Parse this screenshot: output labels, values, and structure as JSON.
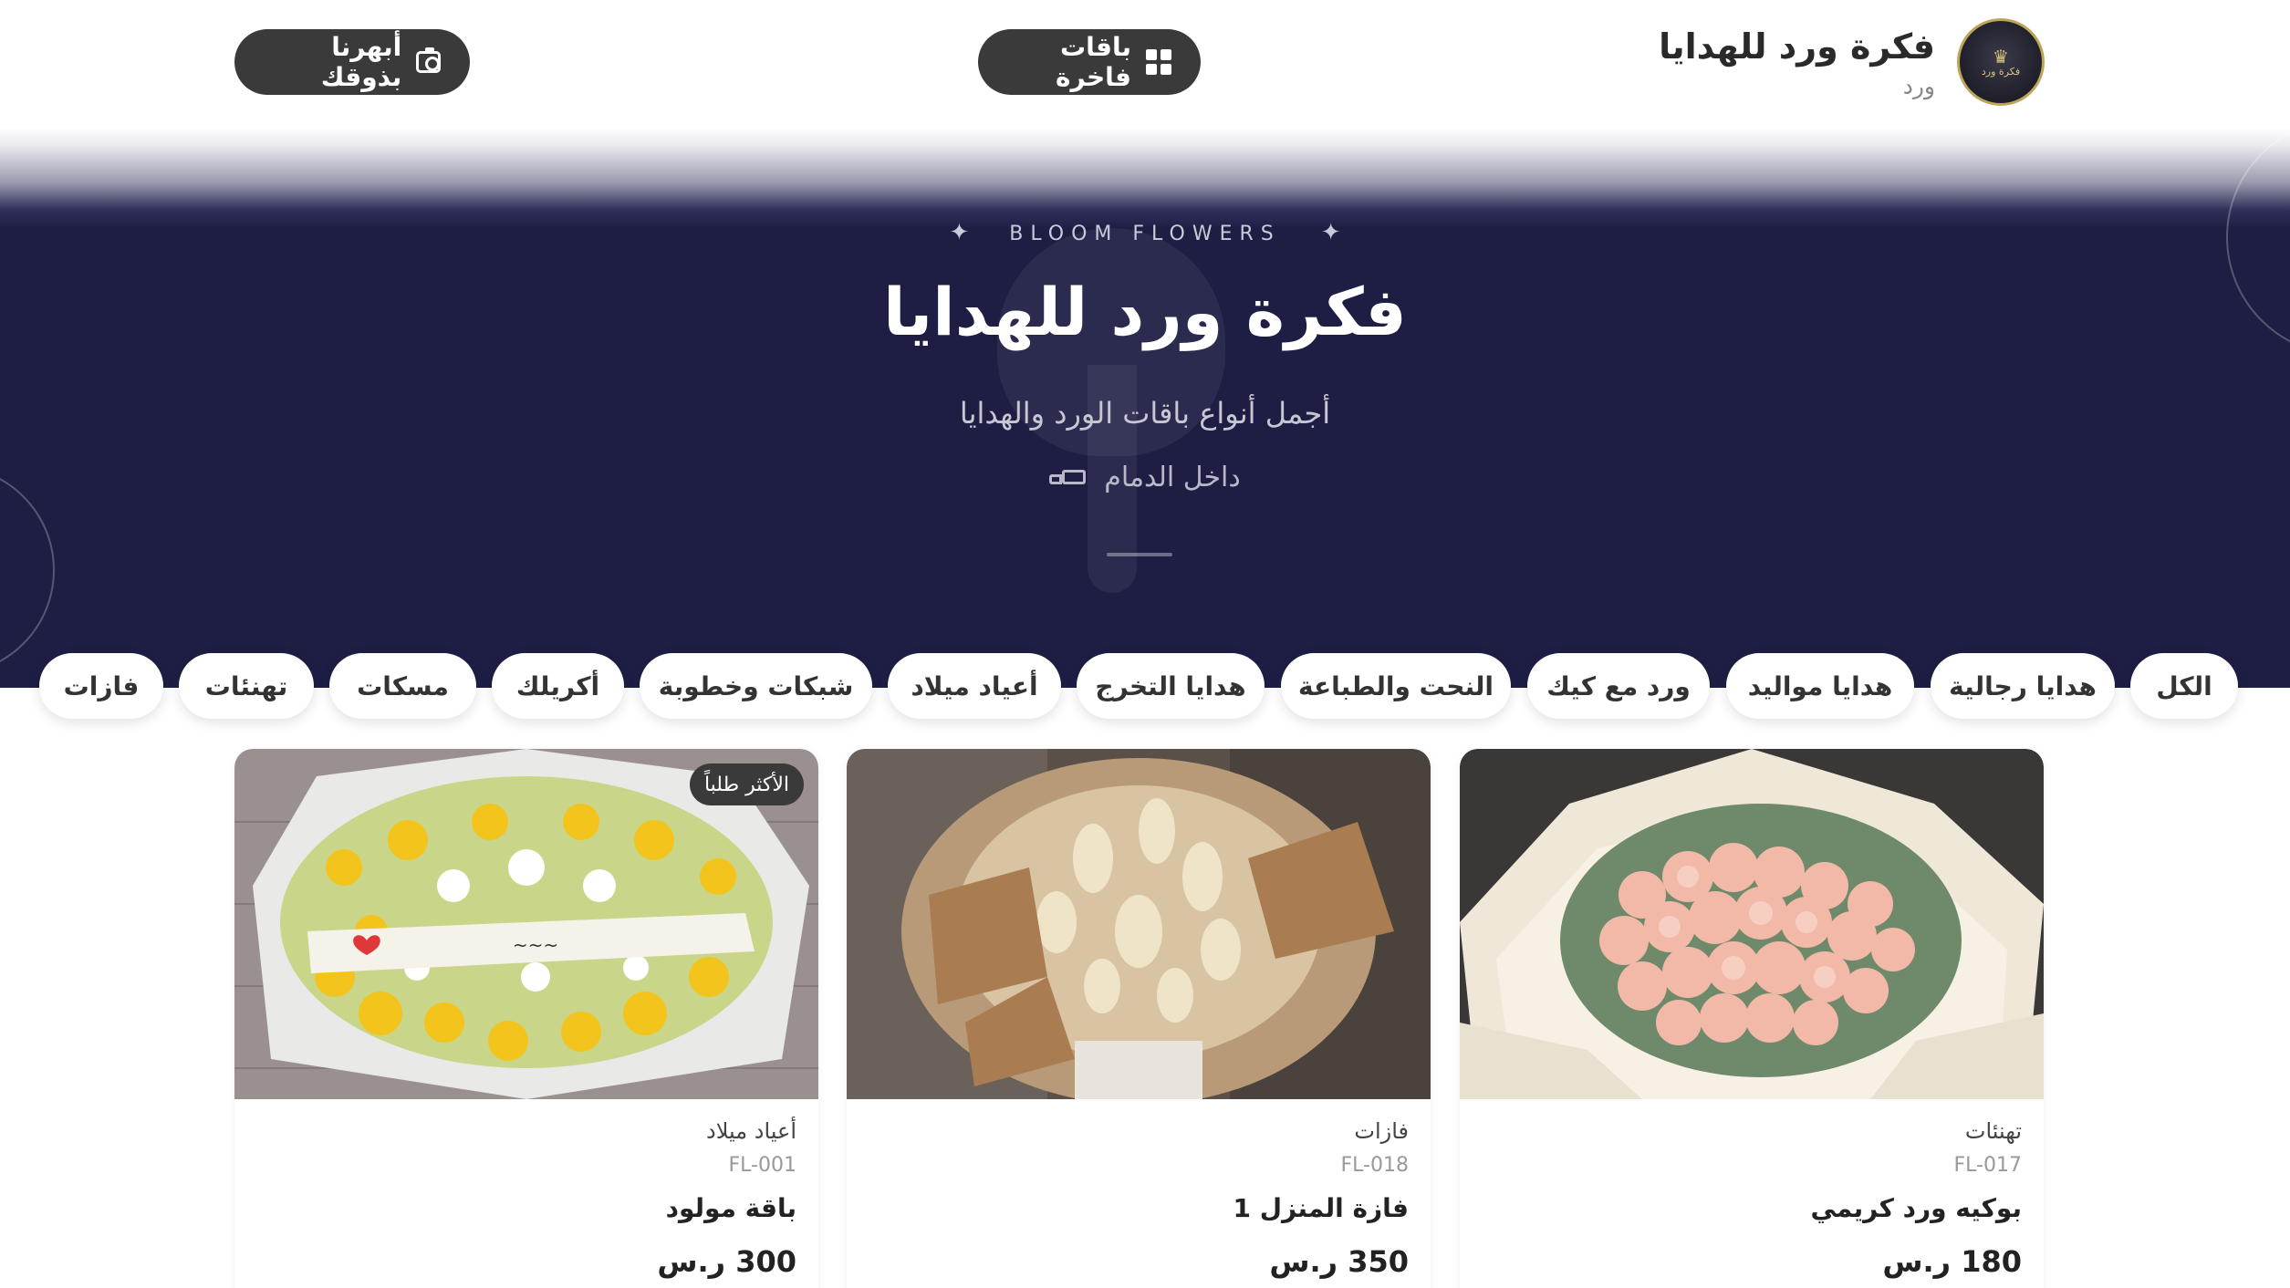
{
  "header": {
    "brand_title": "فكرة ورد للهدايا",
    "brand_subtitle": "ورد",
    "logo_text": "فكرة ورد",
    "luxury_button": "باقات فاخرة",
    "taste_button": "أبهرنا بذوقك"
  },
  "hero": {
    "eyebrow": "BLOOM FLOWERS",
    "title": "فكرة ورد للهدايا",
    "subtitle": "أجمل أنواع باقات الورد والهدايا",
    "location": "داخل الدمام"
  },
  "categories": [
    "الكل",
    "هدايا رجالية",
    "هدايا مواليد",
    "ورد مع كيك",
    "النحت والطباعة",
    "هدايا التخرج",
    "أعياد ميلاد",
    "شبكات وخطوبة",
    "أكريلك",
    "مسكات",
    "تهنئات",
    "فازات"
  ],
  "products": [
    {
      "category": "تهنئات",
      "code": "FL-017",
      "name": "بوكيه ورد كريمي",
      "price": "180 ر.س",
      "badge": "",
      "image": "pink-roses-bouquet"
    },
    {
      "category": "فازات",
      "code": "FL-018",
      "name": "فازة المنزل 1",
      "price": "350 ر.س",
      "badge": "",
      "image": "dried-flowers-vase"
    },
    {
      "category": "أعياد ميلاد",
      "code": "FL-001",
      "name": "باقة مولود",
      "price": "300 ر.س",
      "badge": "الأكثر طلباً",
      "image": "yellow-white-bouquet"
    }
  ],
  "colors": {
    "hero_bg": "#1e1e45",
    "button_bg": "#3a3a3a",
    "accent_gold": "#bfa55a"
  }
}
